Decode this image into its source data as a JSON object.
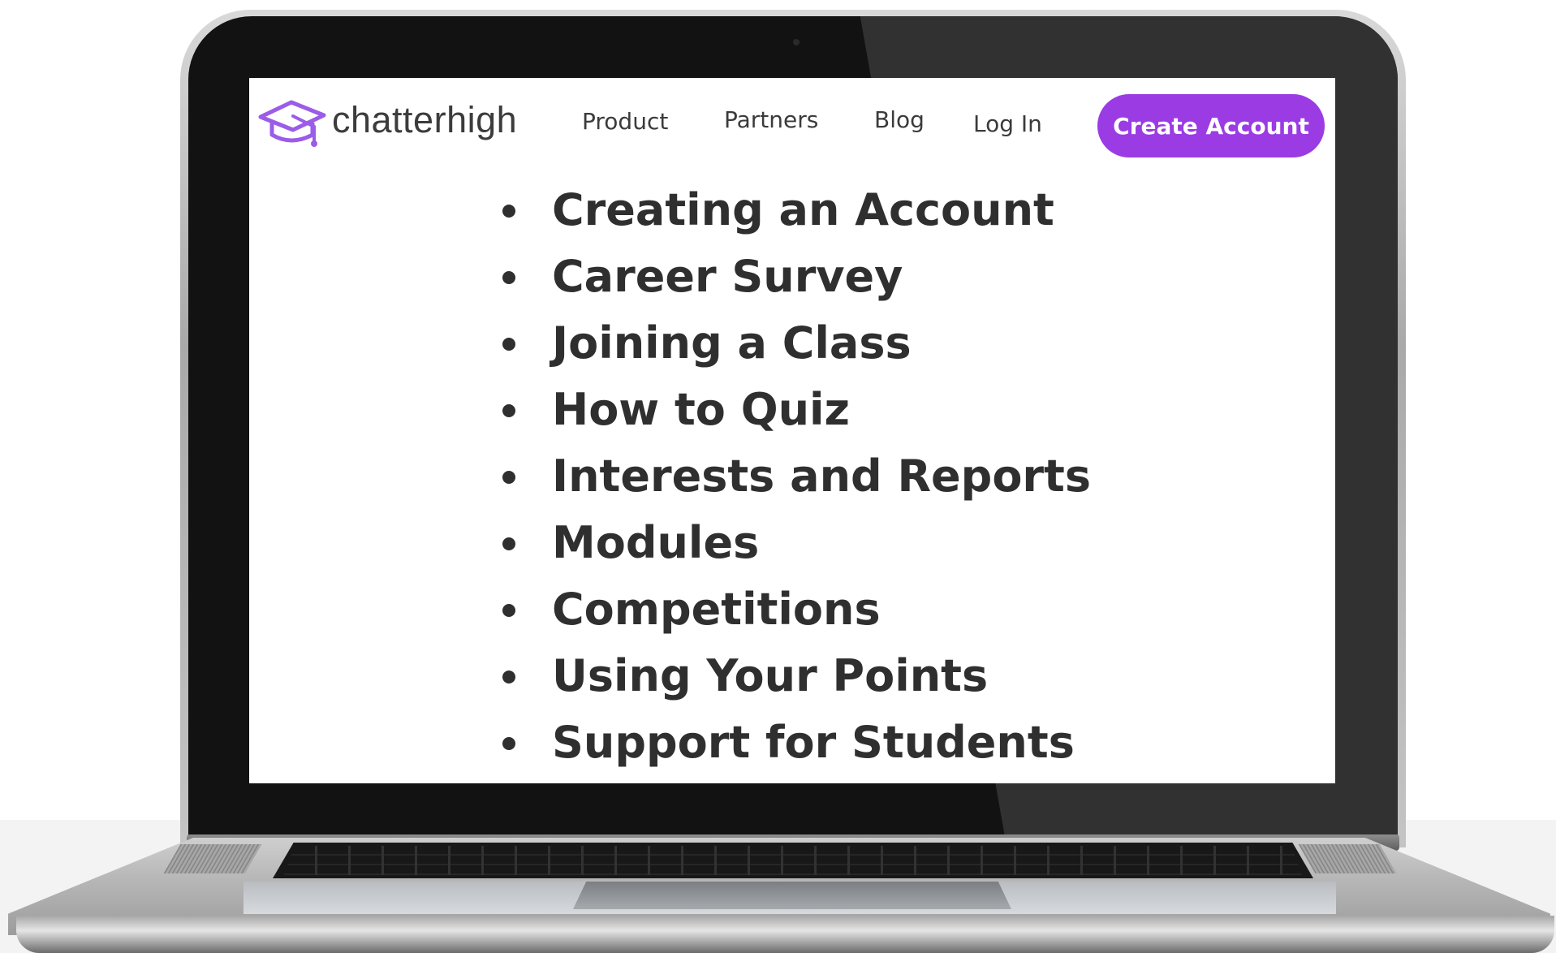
{
  "logo": {
    "text": "chatterhigh",
    "icon": "graduation-cap-icon",
    "color": "#9b5ce8"
  },
  "nav": {
    "links": [
      "Product",
      "Partners",
      "Blog",
      "Log In"
    ],
    "cta_label": "Create Account",
    "cta_color": "#9b3be4"
  },
  "topics": [
    "Creating an Account",
    "Career Survey",
    "Joining a Class",
    "How to Quiz",
    "Interests and Reports",
    "Modules",
    "Competitions",
    "Using Your Points",
    "Support for Students"
  ]
}
